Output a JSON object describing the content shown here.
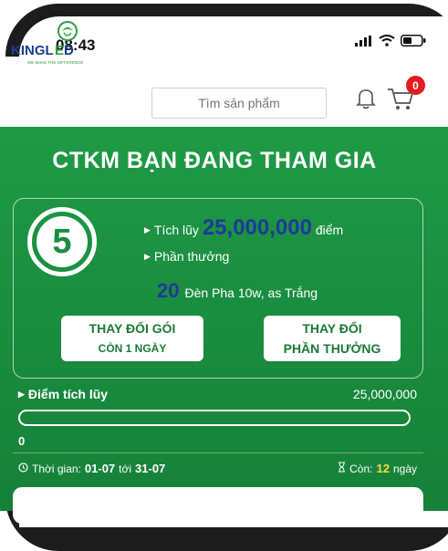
{
  "status_bar": {
    "time": "08:43"
  },
  "header": {
    "logo_text": "KINGLED",
    "logo_slogan": "WE MAKE THE DIFFERENCE",
    "search_placeholder": "Tìm sản phẩm",
    "cart_badge": "0"
  },
  "promo": {
    "title": "CTKM BẠN ĐANG THAM GIA",
    "level": "5",
    "accumulate_prefix": "Tích lũy",
    "accumulate_value": "25,000,000",
    "accumulate_suffix": "điểm",
    "reward_label": "Phần thưởng",
    "reward_qty": "20",
    "reward_item": "Đèn Pha 10w, as Trắng",
    "change_package_line1": "THAY ĐỔI GÓI",
    "change_package_line2": "CÒN 1 NGÀY",
    "change_reward_line1": "THAY ĐỔI",
    "change_reward_line2": "PHẦN THƯỞNG"
  },
  "points": {
    "label": "Điểm tích lũy",
    "target": "25,000,000",
    "current": "0",
    "progress": 0
  },
  "period": {
    "time_label": "Thời gian:",
    "from": "01-07",
    "to_word": "tới",
    "to": "31-07",
    "remaining_label": "Còn:",
    "remaining_days": "12",
    "remaining_unit": "ngày"
  },
  "colors": {
    "primary_green": "#1a8e40",
    "accent_blue": "#1e3a9a",
    "badge_red": "#e51c23",
    "highlight_yellow": "#ffd84a"
  }
}
